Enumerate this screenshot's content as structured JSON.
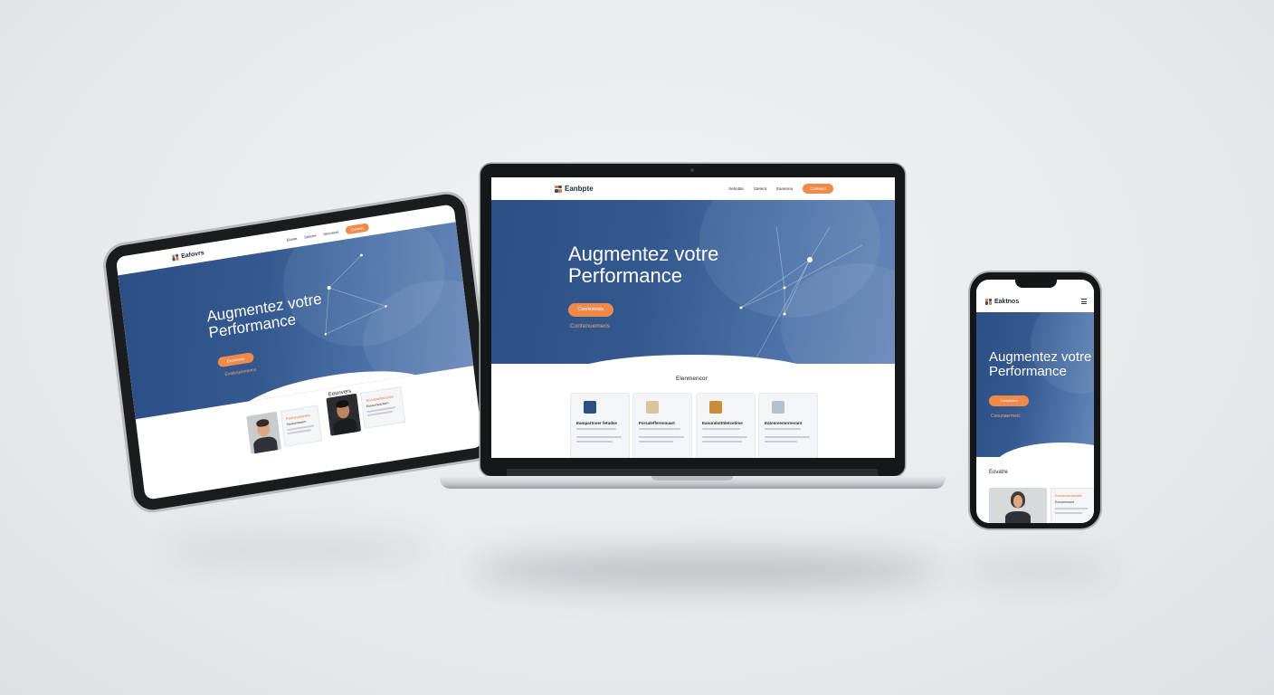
{
  "colors": {
    "brand_blue": "#2b4f86",
    "accent_orange": "#f08a4b",
    "background": "#e8ebed"
  },
  "laptop": {
    "brand": "Eanbpte",
    "nav": [
      "Sebuttia",
      "Steteot",
      "Eanenna"
    ],
    "nav_cta": "Conteact",
    "hero_title_line1": "Augmentez votre",
    "hero_title_line2": "Performance",
    "hero_cta": "Conmuennis",
    "hero_sub": "Contenuemeris",
    "section_title": "Elenmencor",
    "cards": [
      {
        "title": "Eampartnoer fetudse",
        "icon": "team-icon"
      },
      {
        "title": "Forsalefferennuart",
        "icon": "document-icon"
      },
      {
        "title": "Eanuralotttdetcetime",
        "icon": "chart-icon"
      },
      {
        "title": "Eatosreemnrnerant",
        "icon": "report-icon"
      }
    ]
  },
  "tablet": {
    "brand": "Eafovrs",
    "nav": [
      "Etanet",
      "Seecee",
      "Seoceere"
    ],
    "nav_cta": "Contoct",
    "hero_title_line1": "Augmentez votre",
    "hero_title_line2": "Performance",
    "hero_cta": "Evonrnerar",
    "hero_sub": "Evatessiemems",
    "section_title": "Eeunvers",
    "testimonials": [
      {
        "title": "Portheutoanets",
        "subtitle": "Steteumaeem"
      },
      {
        "title": "Teuvanettlarsstos",
        "subtitle": "Esesumeacitem"
      }
    ]
  },
  "phone": {
    "brand": "Eaktnos",
    "menu_icon": "hamburger-icon",
    "hero_title_line1": "Augmentez votre",
    "hero_title_line2": "Performance",
    "hero_cta": "Conatrulns",
    "hero_sub": "Conunaermels",
    "section_title": "Eovatre",
    "testimonial": {
      "title": "Eseuteovaruartuilie",
      "subtitle": "Eonsreenamt"
    }
  }
}
